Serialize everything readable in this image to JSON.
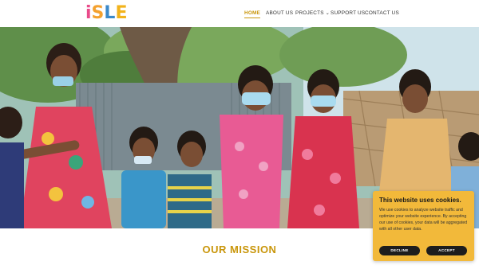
{
  "logo": {
    "letters": [
      "i",
      "S",
      "L",
      "E"
    ],
    "colors": [
      "#e94b8a",
      "#f4a12e",
      "#3b89c9",
      "#f2b31b"
    ]
  },
  "nav": {
    "home": "HOME",
    "about": "ABOUT US",
    "projects": "PROJECTS",
    "support": "SUPPORT US",
    "contact": "CONTACT US"
  },
  "hero": {
    "image": "group-of-children-thumbs-up-photo"
  },
  "mission": {
    "title": "OUR MISSION"
  },
  "cookie": {
    "title": "This website uses cookies.",
    "text": "We use cookies to analyze website traffic and optimize your website experience. By accepting our use of cookies, your data will be aggregated with all other user data.",
    "decline": "DECLINE",
    "accept": "ACCEPT"
  },
  "colors": {
    "accent": "#c9960b",
    "cookie_bg": "#f2b93a",
    "button": "#1d1d1d"
  }
}
